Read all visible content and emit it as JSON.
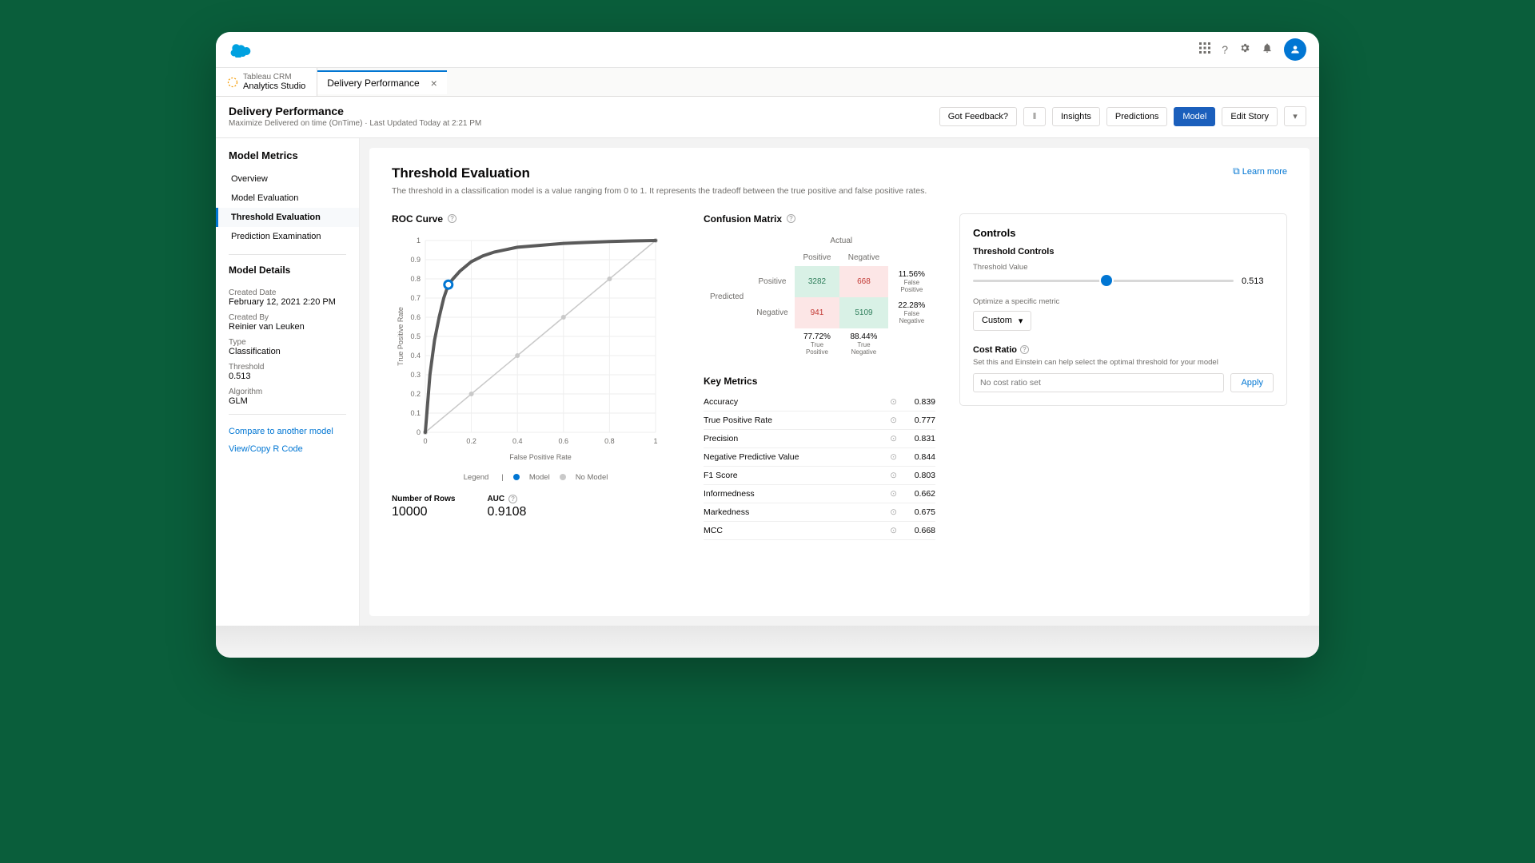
{
  "app": {
    "brand_name": "Tableau CRM",
    "brand_sub": "Analytics Studio",
    "tab_label": "Delivery Performance"
  },
  "header": {
    "title": "Delivery Performance",
    "subtitle": "Maximize Delivered on time (OnTime) · Last Updated Today at 2:21 PM",
    "feedback": "Got Feedback?",
    "btn_insights": "Insights",
    "btn_predictions": "Predictions",
    "btn_model": "Model",
    "btn_edit": "Edit Story"
  },
  "sidebar": {
    "title": "Model Metrics",
    "items": [
      "Overview",
      "Model Evaluation",
      "Threshold Evaluation",
      "Prediction Examination"
    ],
    "active_index": 2,
    "details_title": "Model Details",
    "created_date_lbl": "Created Date",
    "created_date": "February 12, 2021 2:20 PM",
    "created_by_lbl": "Created By",
    "created_by": "Reinier van Leuken",
    "type_lbl": "Type",
    "type_val": "Classification",
    "threshold_lbl": "Threshold",
    "threshold_val": "0.513",
    "algo_lbl": "Algorithm",
    "algo_val": "GLM",
    "link_compare": "Compare to another model",
    "link_rcode": "View/Copy R Code"
  },
  "content": {
    "title": "Threshold Evaluation",
    "learn_more": "Learn more",
    "desc": "The threshold in a classification model is a value ranging from 0 to 1. It represents the tradeoff between the true positive and false positive rates.",
    "roc_title": "ROC Curve",
    "xaxis": "False Positive Rate",
    "yaxis": "True Positive Rate",
    "legend_label": "Legend",
    "legend_model": "Model",
    "legend_nomodel": "No Model",
    "rows_lbl": "Number of Rows",
    "rows_val": "10000",
    "auc_lbl": "AUC",
    "auc_val": "0.9108",
    "conf_title": "Confusion Matrix",
    "conf": {
      "actual": "Actual",
      "predicted": "Predicted",
      "positive": "Positive",
      "negative": "Negative",
      "tp": "3282",
      "fn": "668",
      "fp": "941",
      "tn": "5109",
      "fp_pct": "11.56%",
      "fp_sub": "False Positive",
      "fn_pct": "22.28%",
      "fn_sub": "False Negative",
      "tp_col_pct": "77.72%",
      "tp_sub": "True Positive",
      "tn_col_pct": "88.44%",
      "tn_sub": "True Negative"
    },
    "km_title": "Key Metrics",
    "km": [
      {
        "name": "Accuracy",
        "value": "0.839"
      },
      {
        "name": "True Positive Rate",
        "value": "0.777"
      },
      {
        "name": "Precision",
        "value": "0.831"
      },
      {
        "name": "Negative Predictive Value",
        "value": "0.844"
      },
      {
        "name": "F1 Score",
        "value": "0.803"
      },
      {
        "name": "Informedness",
        "value": "0.662"
      },
      {
        "name": "Markedness",
        "value": "0.675"
      },
      {
        "name": "MCC",
        "value": "0.668"
      }
    ],
    "controls": {
      "title": "Controls",
      "sub": "Threshold Controls",
      "val_lbl": "Threshold Value",
      "val": "0.513",
      "optimize_lbl": "Optimize a specific metric",
      "dropdown": "Custom",
      "cost_title": "Cost Ratio",
      "cost_desc": "Set this and Einstein can help select the optimal threshold for your model",
      "cost_placeholder": "No cost ratio set",
      "apply": "Apply"
    }
  },
  "chart_data": {
    "type": "line",
    "title": "ROC Curve",
    "xlabel": "False Positive Rate",
    "ylabel": "True Positive Rate",
    "xlim": [
      0,
      1
    ],
    "ylim": [
      0,
      1
    ],
    "xticks": [
      0,
      0.2,
      0.4,
      0.6,
      0.8,
      1
    ],
    "yticks": [
      0,
      0.1,
      0.2,
      0.3,
      0.4,
      0.5,
      0.6,
      0.7,
      0.8,
      0.9,
      1
    ],
    "series": [
      {
        "name": "Model",
        "color": "#5a5a5a",
        "x": [
          0.0,
          0.02,
          0.04,
          0.06,
          0.08,
          0.1,
          0.12,
          0.15,
          0.2,
          0.25,
          0.3,
          0.4,
          0.5,
          0.6,
          0.7,
          0.8,
          0.9,
          1.0
        ],
        "values": [
          0.0,
          0.3,
          0.48,
          0.6,
          0.7,
          0.77,
          0.8,
          0.84,
          0.89,
          0.92,
          0.94,
          0.965,
          0.975,
          0.985,
          0.99,
          0.995,
          0.998,
          1.0
        ],
        "marker_point": {
          "x": 0.1,
          "y": 0.77
        }
      },
      {
        "name": "No Model",
        "color": "#c9c9c9",
        "x": [
          0.0,
          0.2,
          0.4,
          0.6,
          0.8,
          1.0
        ],
        "values": [
          0.0,
          0.2,
          0.4,
          0.6,
          0.8,
          1.0
        ]
      }
    ],
    "auc": 0.9108,
    "n_rows": 10000
  }
}
